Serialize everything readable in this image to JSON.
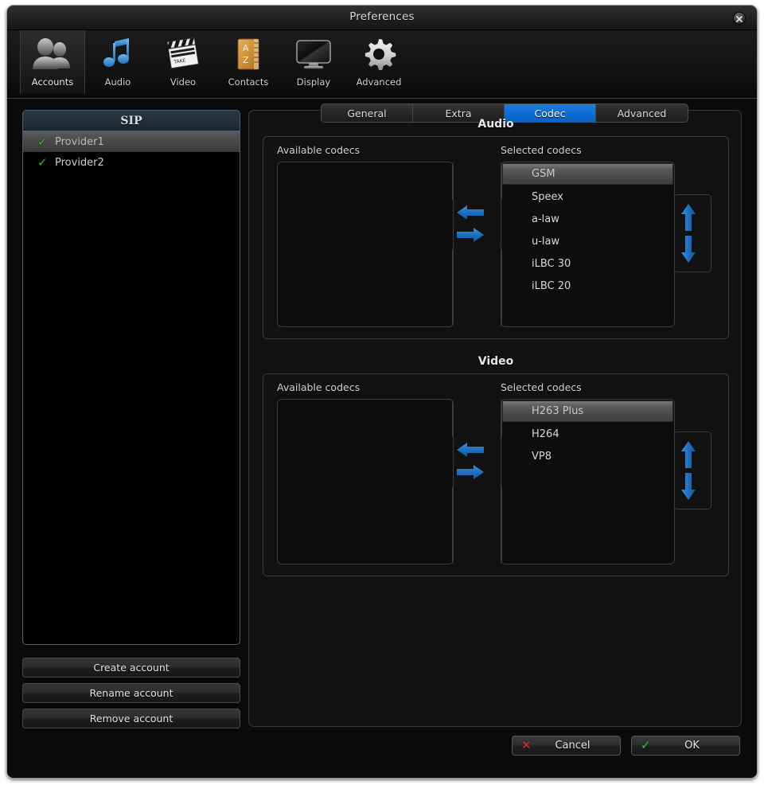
{
  "window": {
    "title": "Preferences",
    "close_icon": "close-circle-icon"
  },
  "toolbar": {
    "items": [
      {
        "label": "Accounts",
        "icon": "people-icon",
        "active": true
      },
      {
        "label": "Audio",
        "icon": "music-note-icon",
        "active": false
      },
      {
        "label": "Video",
        "icon": "clapperboard-icon",
        "active": false
      },
      {
        "label": "Contacts",
        "icon": "address-book-icon",
        "active": false
      },
      {
        "label": "Display",
        "icon": "monitor-icon",
        "active": false
      },
      {
        "label": "Advanced",
        "icon": "gear-icon",
        "active": false
      }
    ]
  },
  "sidebar": {
    "list_header": "SIP",
    "accounts": [
      {
        "name": "Provider1",
        "enabled": true,
        "check": "✓",
        "selected": true
      },
      {
        "name": "Provider2",
        "enabled": true,
        "check": "✓",
        "selected": false
      }
    ],
    "buttons": {
      "create": "Create account",
      "rename": "Rename account",
      "remove": "Remove account"
    }
  },
  "main": {
    "tabs": [
      {
        "label": "General",
        "active": false
      },
      {
        "label": "Extra",
        "active": false
      },
      {
        "label": "Codec",
        "active": true
      },
      {
        "label": "Advanced",
        "active": false
      }
    ],
    "accent_color": "#0e6fd4",
    "groups": [
      {
        "title": "Audio",
        "available_label": "Available codecs",
        "selected_label": "Selected codecs",
        "available_codecs": [],
        "selected_codecs": [
          {
            "name": "GSM",
            "highlight": true
          },
          {
            "name": "Speex",
            "highlight": false
          },
          {
            "name": "a-law",
            "highlight": false
          },
          {
            "name": "u-law",
            "highlight": false
          },
          {
            "name": "iLBC 30",
            "highlight": false
          },
          {
            "name": "iLBC 20",
            "highlight": false
          }
        ]
      },
      {
        "title": "Video",
        "available_label": "Available codecs",
        "selected_label": "Selected codecs",
        "available_codecs": [],
        "selected_codecs": [
          {
            "name": "H263 Plus",
            "highlight": true
          },
          {
            "name": "H264",
            "highlight": false
          },
          {
            "name": "VP8",
            "highlight": false
          }
        ]
      }
    ],
    "transfer_icons": {
      "left": "arrow-left-icon",
      "right": "arrow-right-icon",
      "up": "arrow-up-icon",
      "down": "arrow-down-icon"
    }
  },
  "dialog_buttons": {
    "cancel": {
      "label": "Cancel",
      "glyph": "✕",
      "color": "#d92b2b"
    },
    "ok": {
      "label": "OK",
      "glyph": "✓",
      "color": "#2fc52f"
    }
  }
}
